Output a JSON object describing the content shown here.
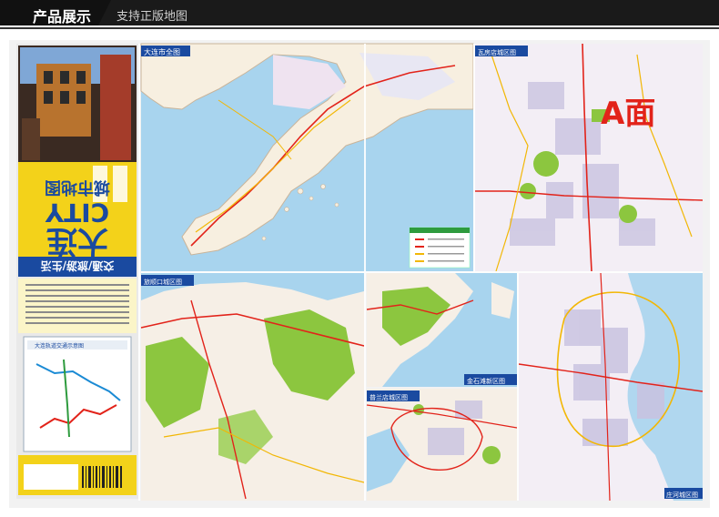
{
  "header": {
    "title": "产品展示",
    "subtitle": "支持正版地图"
  },
  "cover": {
    "title": "大连",
    "city_word": "CITY",
    "subtitle": "城市地图",
    "tagline": "交通/旅游/生活",
    "rail_title": "大连轨道交通示意图"
  },
  "panels": {
    "full_city": "大连市全图",
    "wafangdian": "瓦房店城区图",
    "lushunkou": "旅顺口城区图",
    "jinshitan": "金石滩新区图",
    "pulandian": "普兰店城区图",
    "zhuanghe": "庄河城区图"
  },
  "side_label": "A面",
  "colors": {
    "accent_red": "#e2231a",
    "header_black": "#111111",
    "water_blue": "#a8d4ee",
    "cover_yellow": "#f3d21a",
    "green_area": "#8cc63f"
  }
}
